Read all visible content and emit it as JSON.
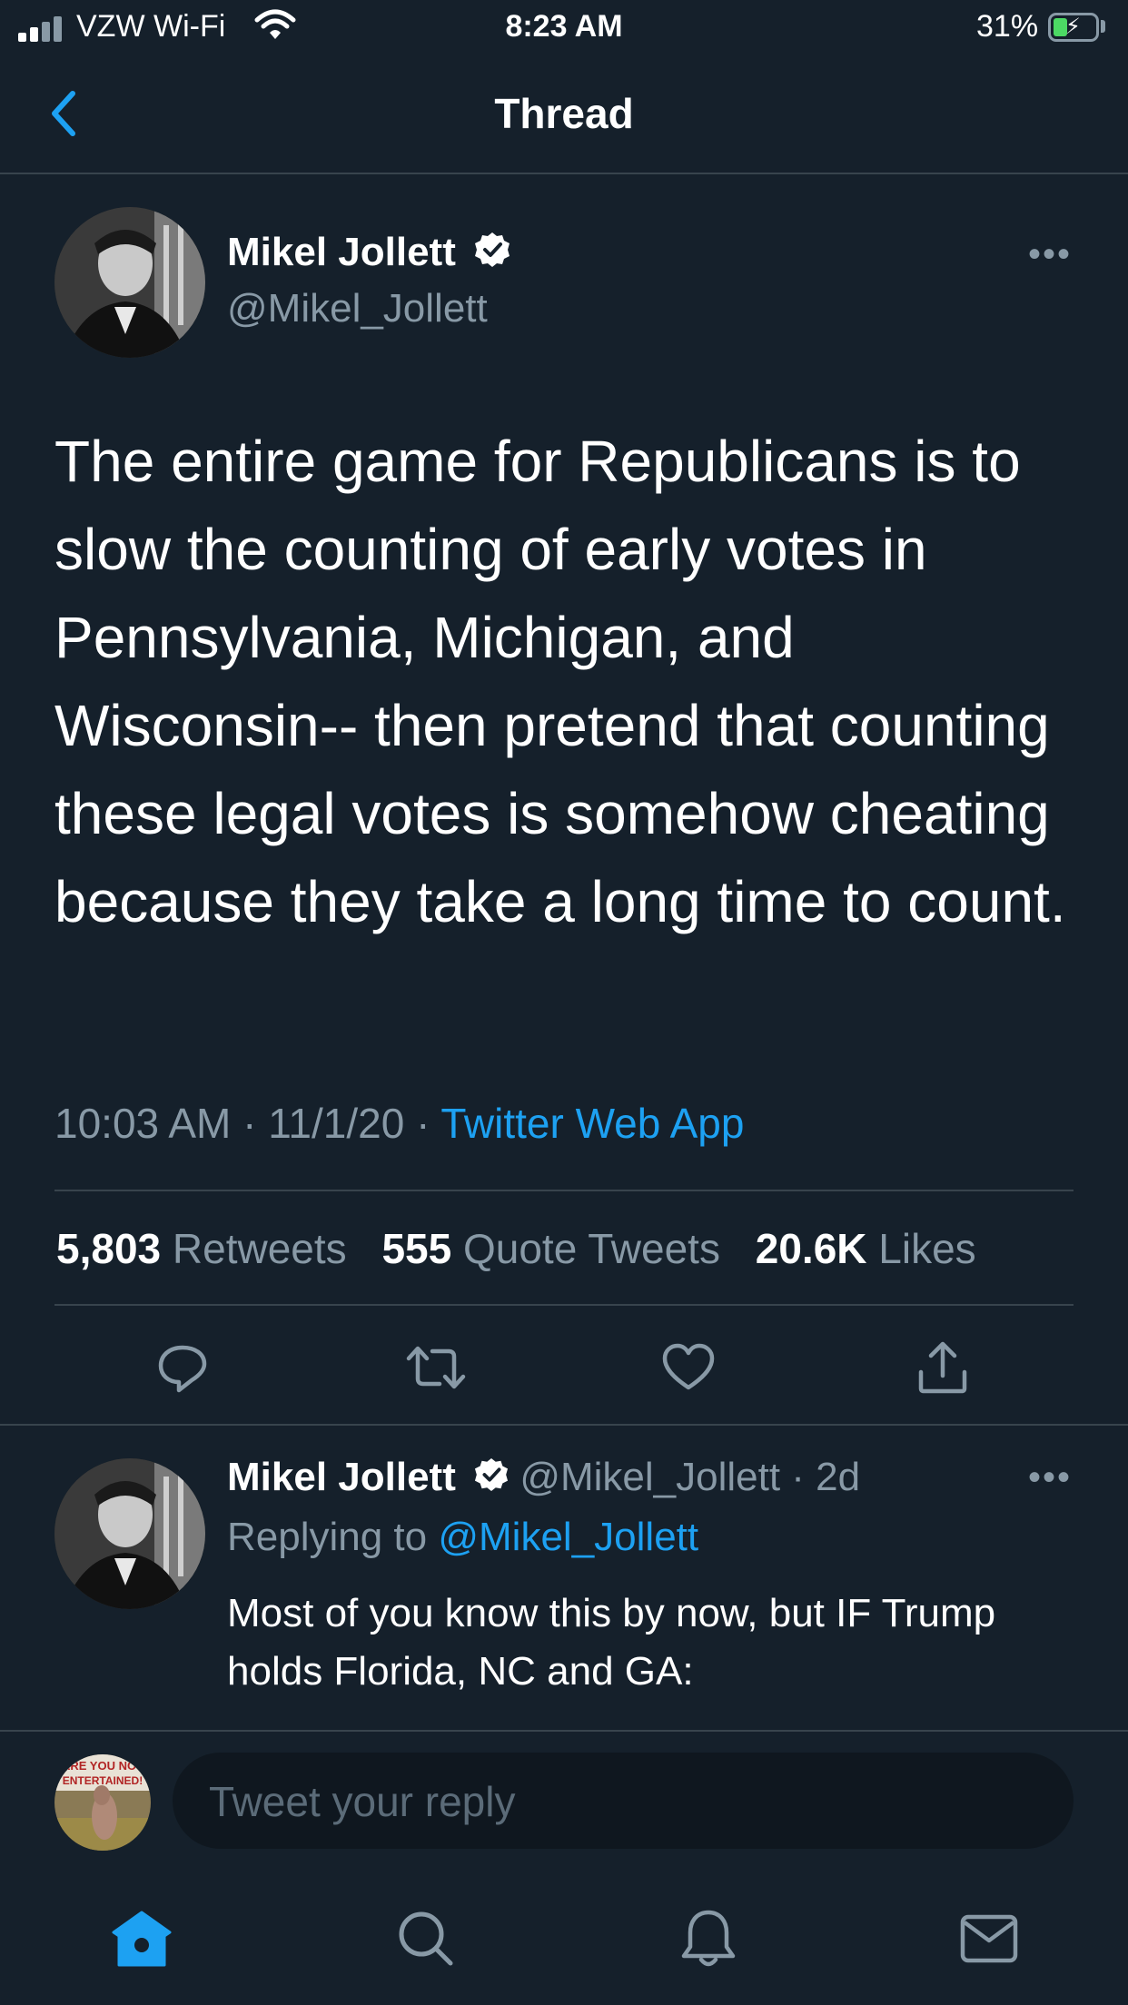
{
  "status_bar": {
    "carrier": "VZW Wi-Fi",
    "time": "8:23 AM",
    "battery": "31%",
    "icons": [
      "signal-icon",
      "wifi-icon",
      "battery-charging-icon"
    ]
  },
  "header": {
    "title": "Thread",
    "icons": [
      "back-chevron-icon"
    ]
  },
  "tweet": {
    "name": "Mikel Jollett",
    "handle": "@Mikel_Jollett",
    "text": "The entire game for Republicans is to slow the counting of early votes in Pennsylvania, Michigan, and Wisconsin-- then pretend that counting these legal votes is somehow cheating because they take a long time to count.",
    "timestamp": "10:03 AM · 11/1/20 · ",
    "source": "Twitter Web App",
    "stats": {
      "retweets_count": "5,803",
      "retweets_label": "Retweets",
      "quotes_count": "555",
      "quotes_label": "Quote Tweets",
      "likes_count": "20.6K",
      "likes_label": "Likes"
    },
    "more": "•••",
    "actions": [
      "reply-icon",
      "retweet-icon",
      "like-icon",
      "share-icon"
    ]
  },
  "reply": {
    "name": "Mikel Jollett",
    "handle_time": "@Mikel_Jollett · 2d",
    "replying_prefix": "Replying to ",
    "replying_to": "@Mikel_Jollett",
    "text": "Most of you know this by now, but IF Trump holds Florida, NC and GA:",
    "more": "•••"
  },
  "composer": {
    "placeholder": "Tweet your reply",
    "avatar_text": "WE YOU NOT ENTERTAINED!"
  },
  "tab_bar": {
    "items": [
      "home-icon",
      "search-icon",
      "notifications-icon",
      "messages-icon"
    ]
  },
  "colors": {
    "background": "#15202b",
    "accent": "#1da1f2",
    "muted": "#8899a6",
    "divider": "#38444d"
  }
}
